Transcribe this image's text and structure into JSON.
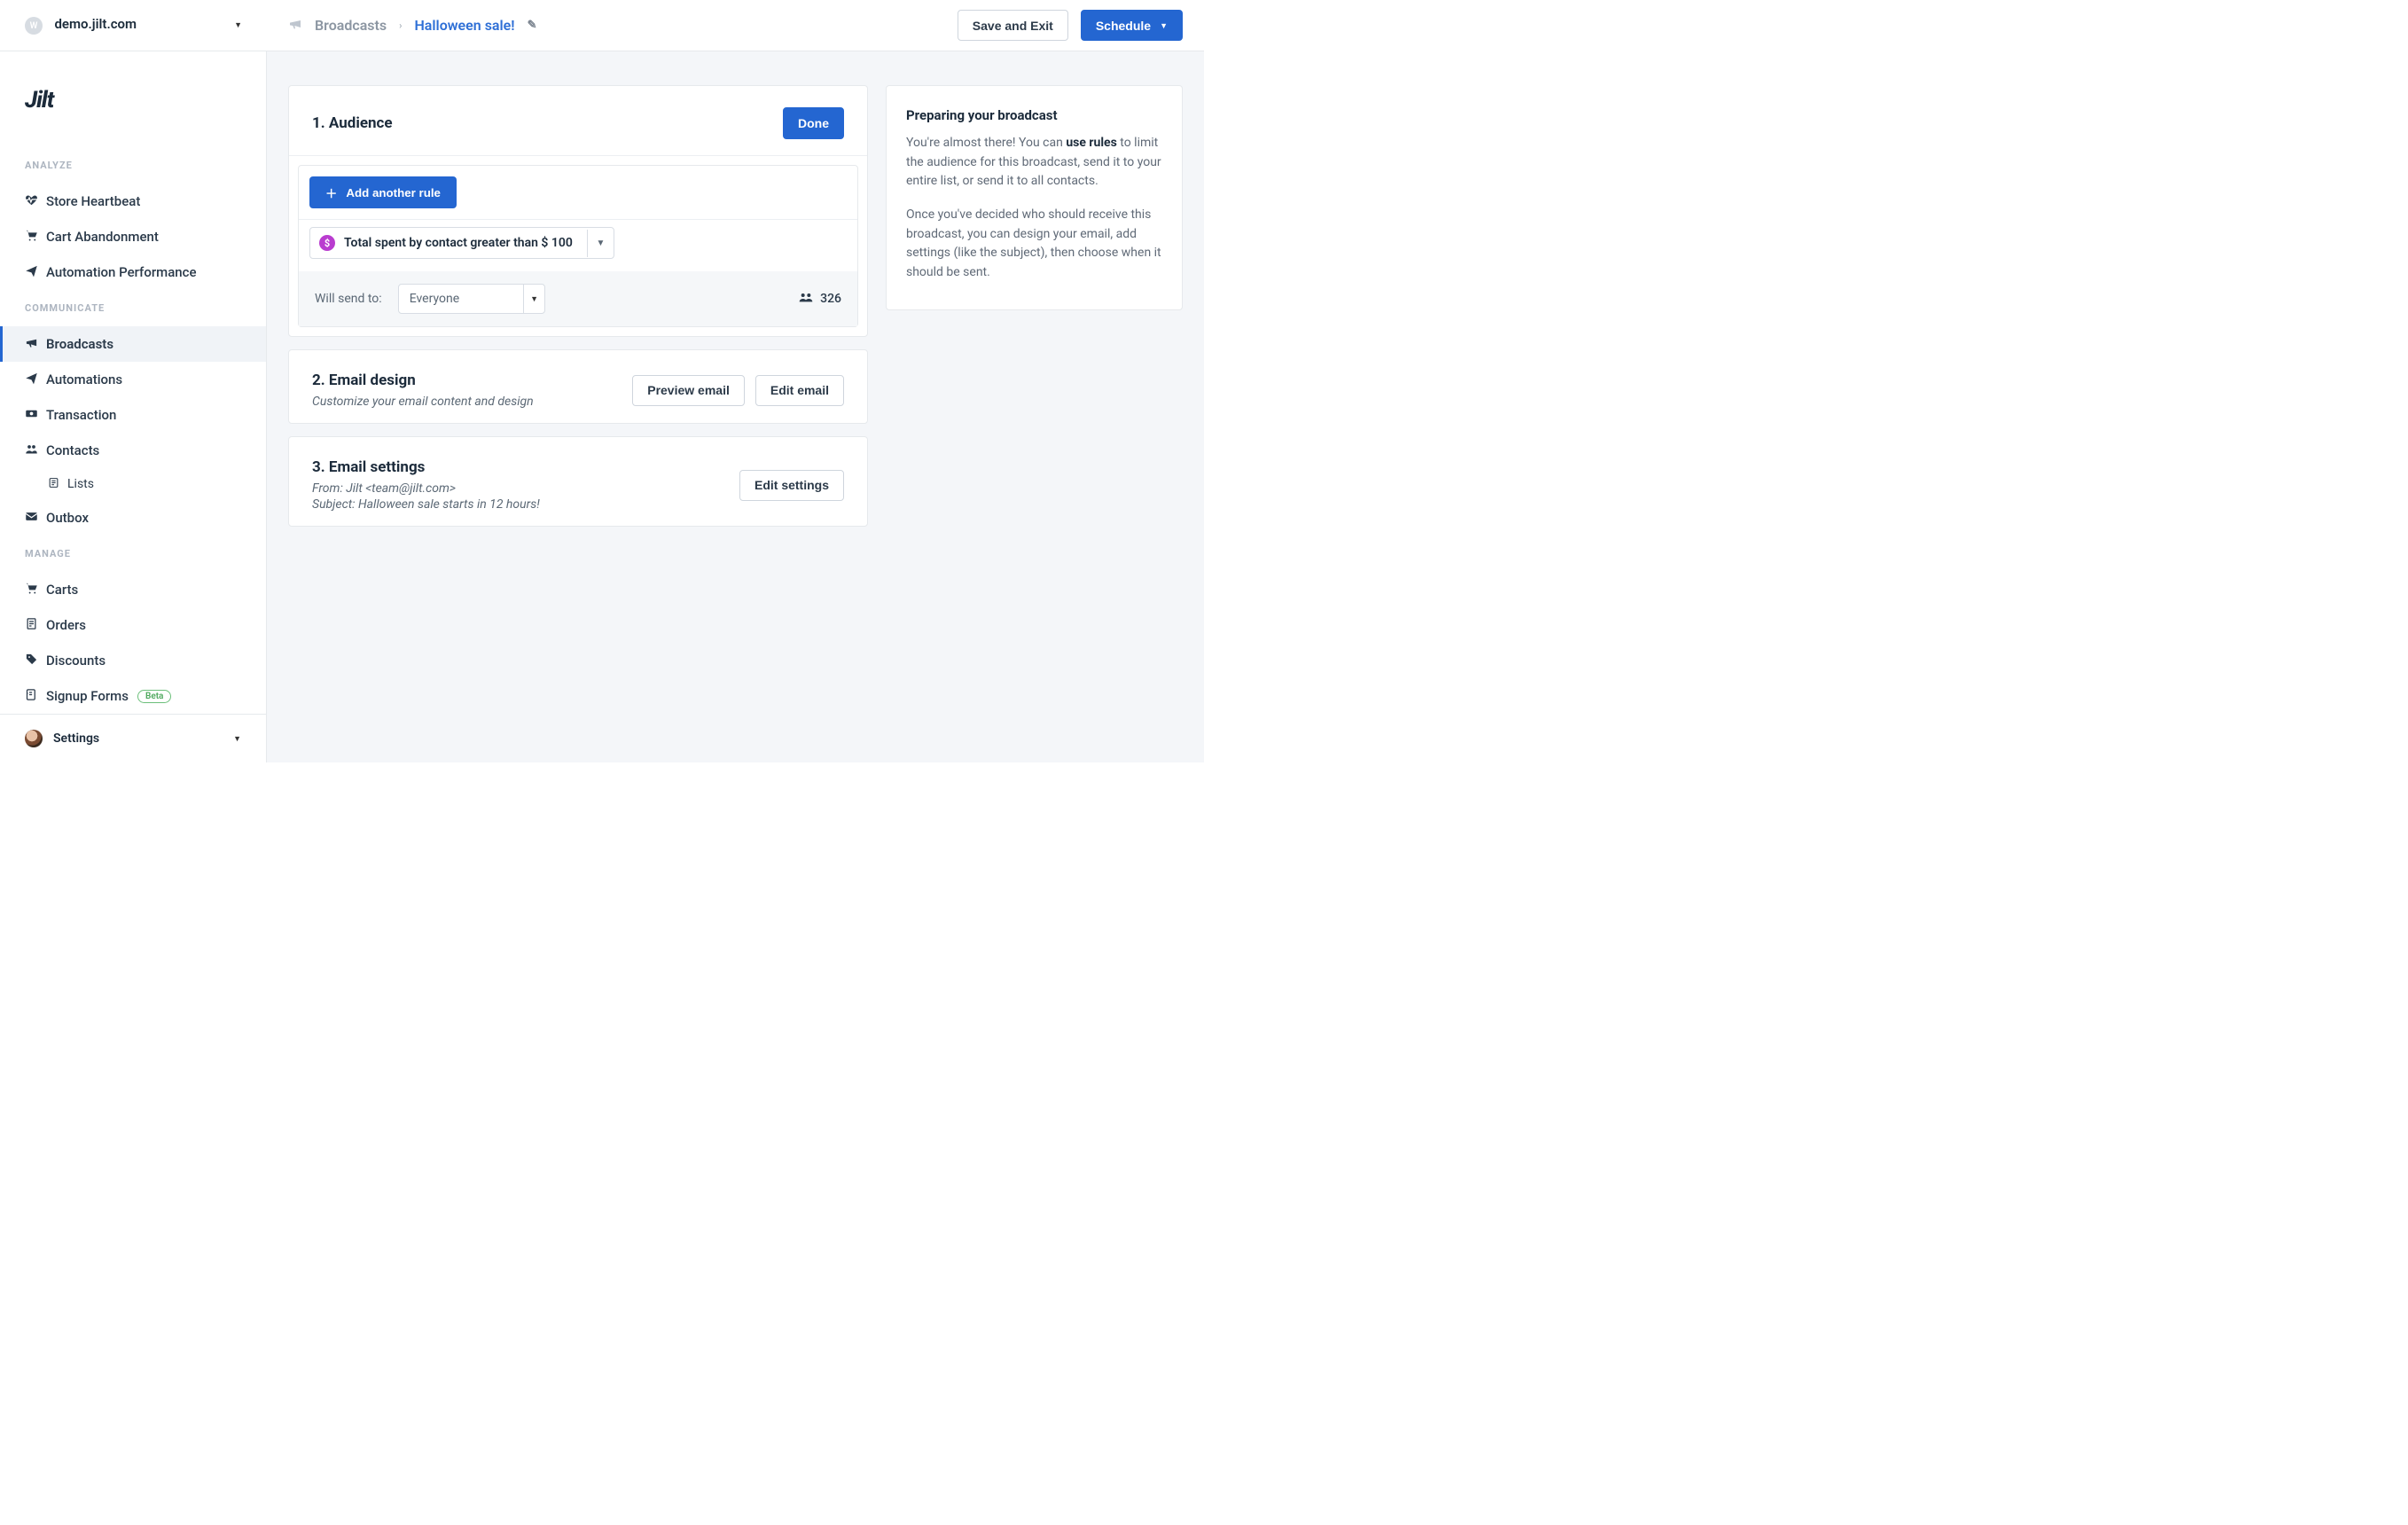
{
  "topbar": {
    "shop_initial": "W",
    "shop_name": "demo.jilt.com",
    "crumb_root": "Broadcasts",
    "crumb_current": "Halloween sale!",
    "save_exit": "Save and Exit",
    "schedule": "Schedule"
  },
  "logo": "Jilt",
  "sidebar": {
    "sections": {
      "analyze": "ANALYZE",
      "communicate": "COMMUNICATE",
      "manage": "MANAGE"
    },
    "analyze": [
      {
        "label": "Store Heartbeat"
      },
      {
        "label": "Cart Abandonment"
      },
      {
        "label": "Automation Performance"
      }
    ],
    "communicate": [
      {
        "label": "Broadcasts",
        "active": true
      },
      {
        "label": "Automations"
      },
      {
        "label": "Transaction"
      },
      {
        "label": "Contacts"
      },
      {
        "label": "Lists",
        "sub": true
      },
      {
        "label": "Outbox"
      }
    ],
    "manage": [
      {
        "label": "Carts"
      },
      {
        "label": "Orders"
      },
      {
        "label": "Discounts"
      },
      {
        "label": "Signup Forms",
        "badge": "Beta"
      }
    ],
    "settings": "Settings"
  },
  "audience": {
    "title": "1. Audience",
    "done": "Done",
    "add_rule": "Add another rule",
    "rule_text": "Total spent by contact greater than $ 100",
    "rule_icon": "$",
    "send_label": "Will send to:",
    "send_value": "Everyone",
    "count": "326"
  },
  "design": {
    "title": "2. Email design",
    "sub": "Customize your email content and design",
    "preview": "Preview email",
    "edit": "Edit email"
  },
  "settings_step": {
    "title": "3. Email settings",
    "from": "From: Jilt <team@jilt.com>",
    "subject": "Subject: Halloween sale starts in 12 hours!",
    "edit": "Edit settings"
  },
  "help": {
    "title": "Preparing your broadcast",
    "p1a": "You're almost there! You can ",
    "p1b": "use rules",
    "p1c": " to limit the audience for this broadcast, send it to your entire list, or send it to all contacts.",
    "p2": "Once you've decided who should receive this broadcast, you can design your email, add settings (like the subject), then choose when it should be sent."
  }
}
